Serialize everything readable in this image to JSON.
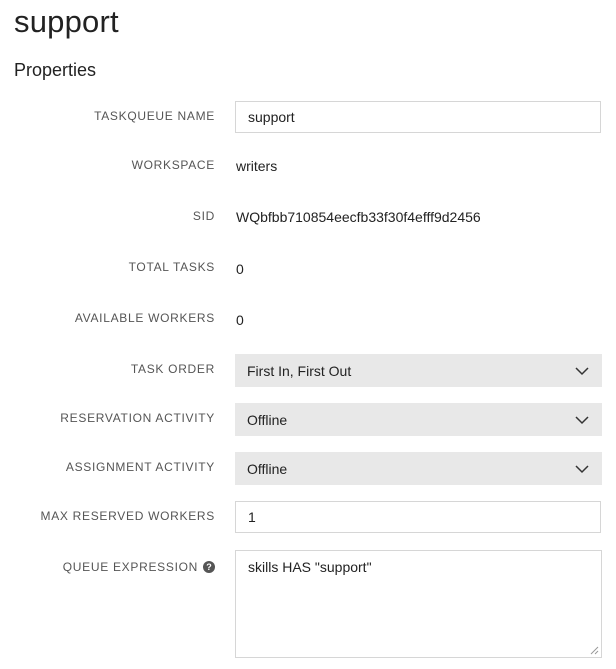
{
  "page": {
    "title": "support",
    "section_title": "Properties"
  },
  "fields": {
    "taskqueue_name": {
      "label": "TASKQUEUE NAME",
      "value": "support"
    },
    "workspace": {
      "label": "WORKSPACE",
      "value": "writers"
    },
    "sid": {
      "label": "SID",
      "value": "WQbfbb710854eecfb33f30f4efff9d2456"
    },
    "total_tasks": {
      "label": "TOTAL TASKS",
      "value": "0"
    },
    "available_workers": {
      "label": "AVAILABLE WORKERS",
      "value": "0"
    },
    "task_order": {
      "label": "TASK ORDER",
      "value": "First In, First Out"
    },
    "reservation_activity": {
      "label": "RESERVATION ACTIVITY",
      "value": "Offline"
    },
    "assignment_activity": {
      "label": "ASSIGNMENT ACTIVITY",
      "value": "Offline"
    },
    "max_reserved_workers": {
      "label": "MAX RESERVED WORKERS",
      "value": "1"
    },
    "queue_expression": {
      "label": "QUEUE EXPRESSION",
      "value": "skills HAS \"support\"",
      "help_icon": "question-circle-icon"
    }
  },
  "colors": {
    "select_bg": "#e8e8e8",
    "label": "#555555",
    "text": "#222222",
    "border": "#d6d6d6"
  }
}
